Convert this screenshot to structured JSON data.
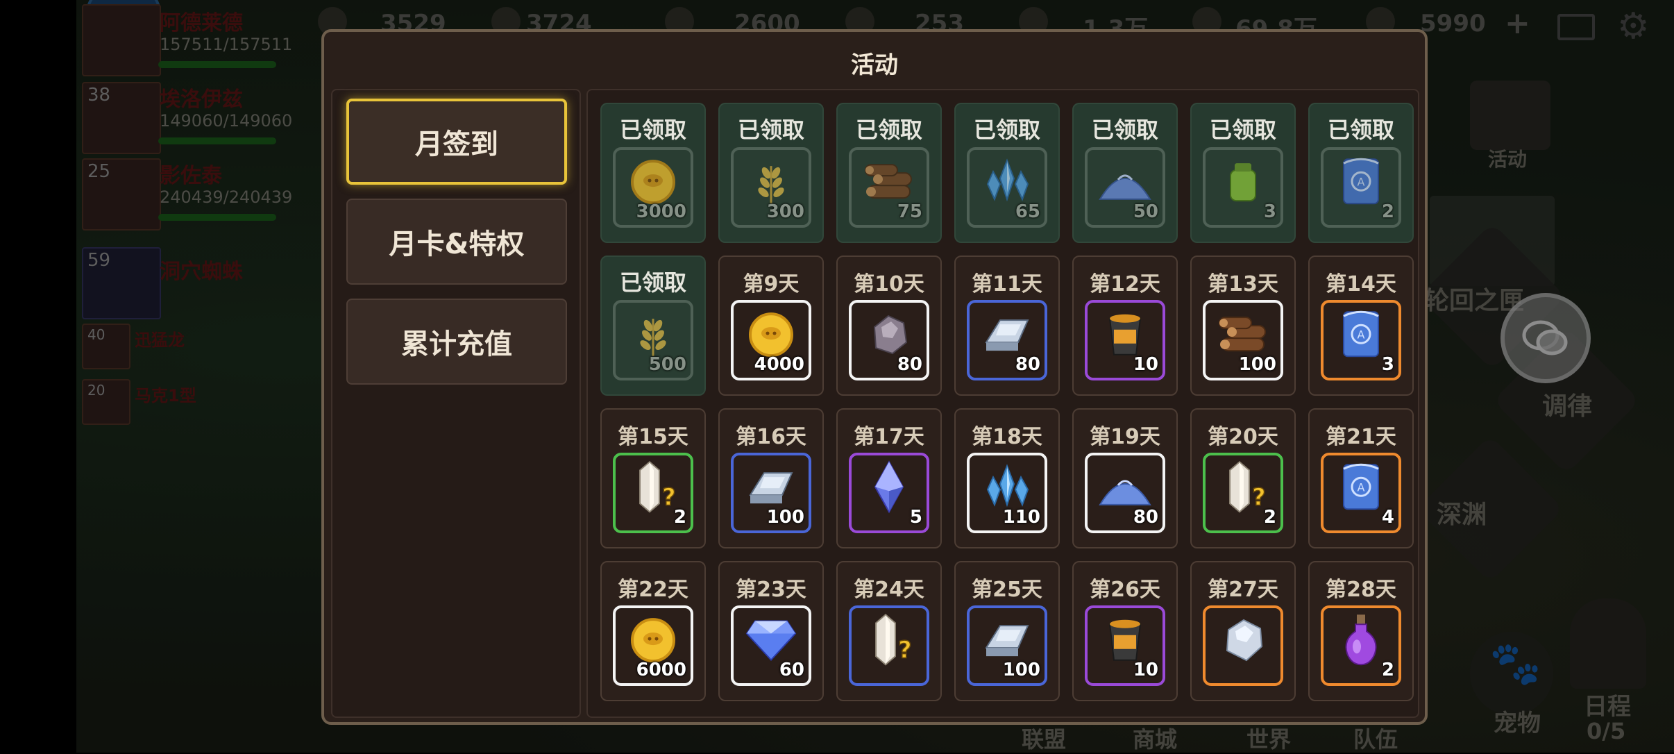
{
  "panel": {
    "title": "活动"
  },
  "tabs": [
    {
      "label": "月签到",
      "selected": true
    },
    {
      "label": "月卡&特权",
      "selected": false
    },
    {
      "label": "累计充值",
      "selected": false
    }
  ],
  "days": [
    {
      "label": "已领取",
      "item": "gold-coin-icon",
      "qty": "3000",
      "claimed": true,
      "border": "white"
    },
    {
      "label": "已领取",
      "item": "wheat-icon",
      "qty": "300",
      "claimed": true,
      "border": "white"
    },
    {
      "label": "已领取",
      "item": "wood-logs-icon",
      "qty": "75",
      "claimed": true,
      "border": "white"
    },
    {
      "label": "已领取",
      "item": "crystal-icon",
      "qty": "65",
      "claimed": true,
      "border": "white"
    },
    {
      "label": "已领取",
      "item": "sand-pile-icon",
      "qty": "50",
      "claimed": true,
      "border": "white"
    },
    {
      "label": "已领取",
      "item": "jar-icon",
      "qty": "3",
      "claimed": true,
      "border": "white"
    },
    {
      "label": "已领取",
      "item": "scroll-icon",
      "qty": "2",
      "claimed": true,
      "border": "orange"
    },
    {
      "label": "已领取",
      "item": "wheat-icon",
      "qty": "500",
      "claimed": true,
      "border": "white"
    },
    {
      "label": "第9天",
      "item": "gold-coin-icon",
      "qty": "4000",
      "claimed": false,
      "border": "white"
    },
    {
      "label": "第10天",
      "item": "ore-icon",
      "qty": "80",
      "claimed": false,
      "border": "white"
    },
    {
      "label": "第11天",
      "item": "iron-ingot-icon",
      "qty": "80",
      "claimed": false,
      "border": "blue"
    },
    {
      "label": "第12天",
      "item": "bucket-icon",
      "qty": "10",
      "claimed": false,
      "border": "purple"
    },
    {
      "label": "第13天",
      "item": "wood-logs-icon",
      "qty": "100",
      "claimed": false,
      "border": "white"
    },
    {
      "label": "第14天",
      "item": "scroll-icon",
      "qty": "3",
      "claimed": false,
      "border": "orange"
    },
    {
      "label": "第15天",
      "item": "mystery-crystal-icon",
      "qty": "2",
      "claimed": false,
      "border": "green"
    },
    {
      "label": "第16天",
      "item": "iron-ingot-icon",
      "qty": "100",
      "claimed": false,
      "border": "blue"
    },
    {
      "label": "第17天",
      "item": "soul-gem-icon",
      "qty": "5",
      "claimed": false,
      "border": "purple"
    },
    {
      "label": "第18天",
      "item": "crystal-icon",
      "qty": "110",
      "claimed": false,
      "border": "white"
    },
    {
      "label": "第19天",
      "item": "sand-pile-icon",
      "qty": "80",
      "claimed": false,
      "border": "white"
    },
    {
      "label": "第20天",
      "item": "mystery-crystal-icon",
      "qty": "2",
      "claimed": false,
      "border": "green"
    },
    {
      "label": "第21天",
      "item": "scroll-icon",
      "qty": "4",
      "claimed": false,
      "border": "orange"
    },
    {
      "label": "第22天",
      "item": "gold-coin-icon",
      "qty": "6000",
      "claimed": false,
      "border": "white"
    },
    {
      "label": "第23天",
      "item": "diamond-icon",
      "qty": "60",
      "claimed": false,
      "border": "white"
    },
    {
      "label": "第24天",
      "item": "mystery-crystal-icon",
      "qty": "",
      "claimed": false,
      "border": "blue"
    },
    {
      "label": "第25天",
      "item": "iron-ingot-icon",
      "qty": "100",
      "claimed": false,
      "border": "blue"
    },
    {
      "label": "第26天",
      "item": "bucket-icon",
      "qty": "10",
      "claimed": false,
      "border": "purple"
    },
    {
      "label": "第27天",
      "item": "silver-stone-icon",
      "qty": "",
      "claimed": false,
      "border": "orange"
    },
    {
      "label": "第28天",
      "item": "potion-icon",
      "qty": "2",
      "claimed": false,
      "border": "orange"
    }
  ],
  "hud": {
    "resources": [
      "3529",
      "3724",
      "2600",
      "253",
      "1.3万",
      "69.8万",
      "5990"
    ],
    "party": [
      {
        "level": "",
        "name": "阿德莱德",
        "hp": "157511/157511"
      },
      {
        "level": "38",
        "name": "埃洛伊兹",
        "hp": "149060/149060"
      },
      {
        "level": "25",
        "name": "影佐泰",
        "hp": "240439/240439"
      },
      {
        "level": "59",
        "name": "洞穴蜘蛛",
        "hp": ""
      },
      {
        "level": "40",
        "name": "迅猛龙",
        "hp": ""
      },
      {
        "level": "20",
        "name": "马克1型",
        "hp": ""
      }
    ],
    "activity_label": "活动",
    "side_labels": [
      "轮回之匣",
      "调律",
      "深渊"
    ],
    "pet_label": "宠物",
    "schedule_label": "日程",
    "schedule_count": "0/5",
    "bottom_tabs": [
      "联盟",
      "商城",
      "世界",
      "队伍"
    ],
    "add_symbol": "+"
  },
  "colors": {
    "accent_selected": "#e8c43a",
    "claimed_bg": "#263a2f",
    "rarity_white": "#f4f4f4",
    "rarity_blue": "#4a66d8",
    "rarity_purple": "#9a4ad8",
    "rarity_orange": "#ef8a2e",
    "rarity_green": "#4cc04c"
  }
}
